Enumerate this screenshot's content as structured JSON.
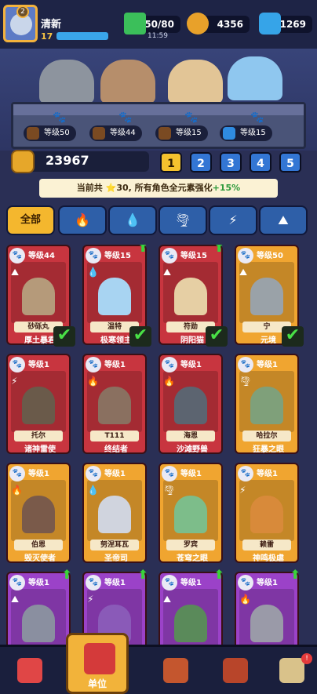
{
  "player": {
    "name": "清新",
    "level": "17",
    "avatar_level": "2"
  },
  "resources": {
    "energy": "50/80",
    "energy_timer": "11:59",
    "coins": "4356",
    "gems": "1269"
  },
  "team_tags": [
    {
      "label": "等级50",
      "element": "earth"
    },
    {
      "label": "等级44",
      "element": "earth"
    },
    {
      "label": "等级15",
      "element": "earth"
    },
    {
      "label": "等级15",
      "element": "water"
    }
  ],
  "gold_total": "23967",
  "pages": [
    "1",
    "2",
    "3",
    "4",
    "5"
  ],
  "active_page": "1",
  "banner": {
    "prefix": "当前共",
    "count": "30",
    "suffix": "所有角色全元素强化",
    "bonus": "+15%"
  },
  "filters": [
    {
      "label": "全部",
      "icon": "all"
    },
    {
      "label": "🔥",
      "icon": "fire-icon"
    },
    {
      "label": "💧",
      "icon": "water-icon"
    },
    {
      "label": "🌪",
      "icon": "wind-icon"
    },
    {
      "label": "⚡",
      "icon": "lightning-icon"
    },
    {
      "label": "⛰",
      "icon": "earth-icon"
    }
  ],
  "cards": [
    {
      "level": "等级44",
      "name": "砂砾丸",
      "title": "厚土暴君",
      "element": "⛰",
      "color": "#c8353f",
      "checked": true,
      "upgrade": false
    },
    {
      "level": "等级15",
      "name": "温特",
      "title": "极寒领主",
      "element": "💧",
      "color": "#c8353f",
      "checked": true,
      "upgrade": true
    },
    {
      "level": "等级15",
      "name": "符勋",
      "title": "阴阳猫",
      "element": "⛰",
      "color": "#c8353f",
      "checked": true,
      "upgrade": true
    },
    {
      "level": "等级50",
      "name": "宁",
      "title": "元境",
      "element": "⛰",
      "color": "#f0a530",
      "checked": true,
      "upgrade": false
    },
    {
      "level": "等级1",
      "name": "托尔",
      "title": "诸神雷使",
      "element": "⚡",
      "color": "#c8353f",
      "checked": false,
      "upgrade": false
    },
    {
      "level": "等级1",
      "name": "T111",
      "title": "终结者",
      "element": "🔥",
      "color": "#c8353f",
      "checked": false,
      "upgrade": false
    },
    {
      "level": "等级1",
      "name": "海恩",
      "title": "沙滩野兽",
      "element": "🔥",
      "color": "#c8353f",
      "checked": false,
      "upgrade": false
    },
    {
      "level": "等级1",
      "name": "哈拉尔",
      "title": "狂暴之眼",
      "element": "🌪",
      "color": "#f0a530",
      "checked": false,
      "upgrade": false
    },
    {
      "level": "等级1",
      "name": "伯恩",
      "title": "毁灭使者",
      "element": "🔥",
      "color": "#f0a530",
      "checked": false,
      "upgrade": false
    },
    {
      "level": "等级1",
      "name": "努涅耳瓦",
      "title": "圣帝司",
      "element": "💧",
      "color": "#f0a530",
      "checked": false,
      "upgrade": false
    },
    {
      "level": "等级1",
      "name": "罗宾",
      "title": "苍穹之眼",
      "element": "🌪",
      "color": "#f0a530",
      "checked": false,
      "upgrade": false
    },
    {
      "level": "等级1",
      "name": "赖雷",
      "title": "神鸣极虐",
      "element": "⚡",
      "color": "#f0a530",
      "checked": false,
      "upgrade": false
    },
    {
      "level": "等级1",
      "name": "",
      "title": "",
      "element": "⛰",
      "color": "#9b42c8",
      "checked": false,
      "upgrade": true
    },
    {
      "level": "等级1",
      "name": "",
      "title": "",
      "element": "⚡",
      "color": "#9b42c8",
      "checked": false,
      "upgrade": true
    },
    {
      "level": "等级1",
      "name": "",
      "title": "",
      "element": "⛰",
      "color": "#9b42c8",
      "checked": false,
      "upgrade": true
    },
    {
      "level": "等级1",
      "name": "",
      "title": "",
      "element": "🔥",
      "color": "#9b42c8",
      "checked": false,
      "upgrade": true
    }
  ],
  "nav": [
    {
      "label": "",
      "icon": "shop-icon"
    },
    {
      "label": "单位",
      "icon": "units-icon"
    },
    {
      "label": "",
      "icon": "battle-icon"
    },
    {
      "label": "",
      "icon": "ship-icon"
    },
    {
      "label": "",
      "icon": "map-icon",
      "badge": "!"
    }
  ]
}
